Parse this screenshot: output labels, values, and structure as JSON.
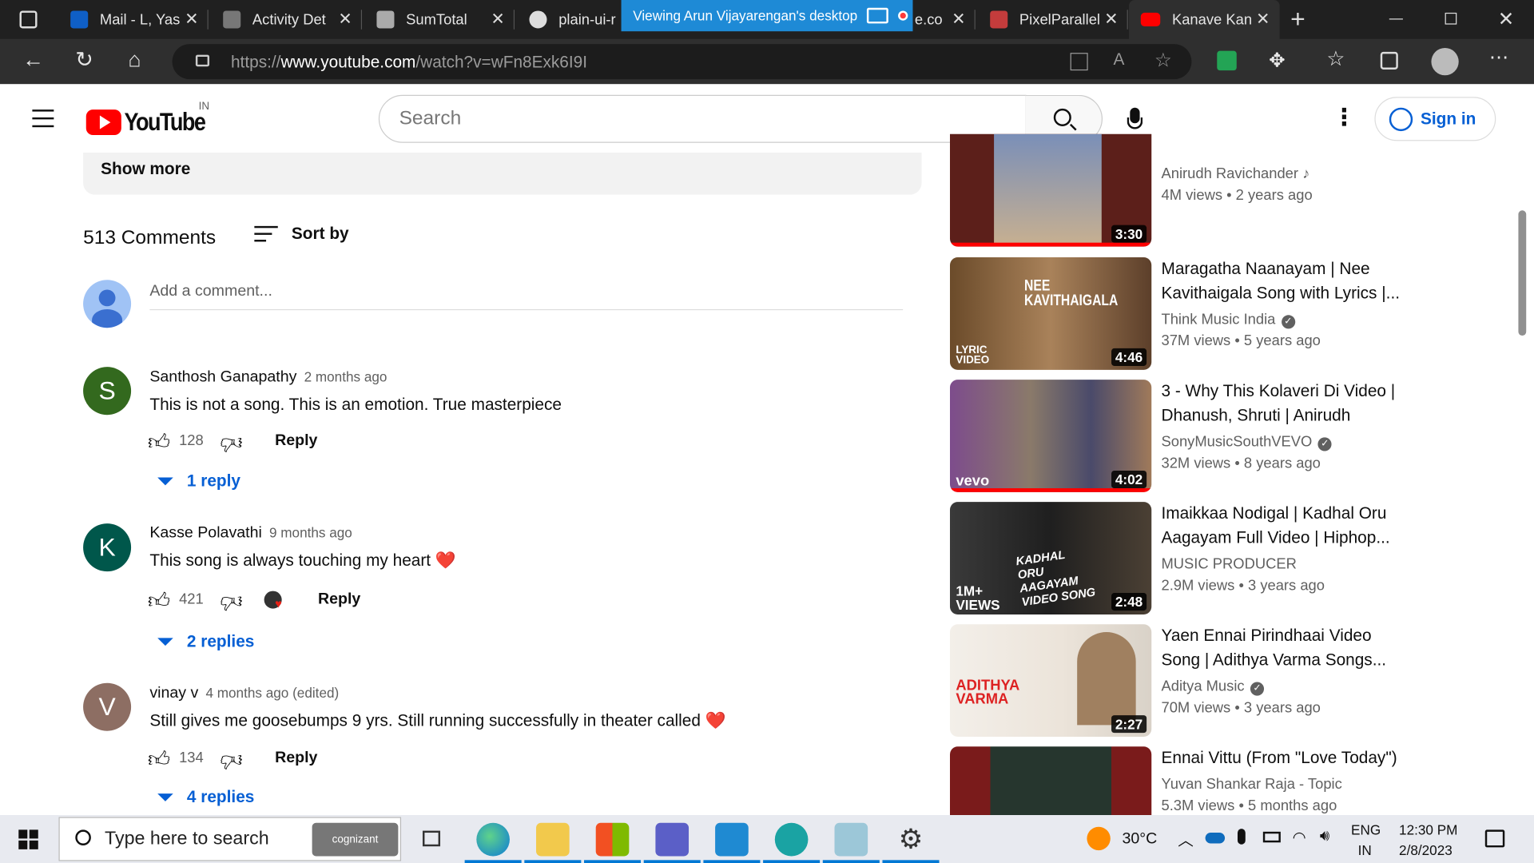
{
  "browser": {
    "tabs": [
      {
        "label": "Mail - L, Yas"
      },
      {
        "label": "Activity Det"
      },
      {
        "label": "SumTotal"
      },
      {
        "label": "plain-ui-r"
      },
      {
        "label": "e.co"
      },
      {
        "label": "PixelParallel"
      },
      {
        "label": "Kanave Kan"
      }
    ],
    "share_banner": "Viewing Arun Vijayarengan's desktop",
    "url_prefix": "https://",
    "url_domain": "www.youtube.com",
    "url_path": "/watch?v=wFn8Exk6I9I"
  },
  "youtube": {
    "logo_text": "YouTube",
    "region": "IN",
    "search_placeholder": "Search",
    "sign_in": "Sign in"
  },
  "description": {
    "show_more": "Show more"
  },
  "comments_section": {
    "count_label": "513 Comments",
    "sort_label": "Sort by",
    "add_placeholder": "Add a comment...",
    "comments": [
      {
        "initial": "S",
        "color": "#33691e",
        "author": "Santhosh Ganapathy",
        "time": "2 months ago",
        "text": "This is not a song. This is an emotion. True masterpiece",
        "likes": "128",
        "reply": "Reply",
        "replies": "1 reply"
      },
      {
        "initial": "K",
        "color": "#00574b",
        "author": "Kasse Polavathi",
        "time": "9 months ago",
        "text": "This song is always touching my heart ❤️",
        "likes": "421",
        "reply": "Reply",
        "replies": "2 replies"
      },
      {
        "initial": "V",
        "color": "#8d6e63",
        "author": "vinay v",
        "time": "4 months ago (edited)",
        "text": "Still gives me goosebumps 9 yrs. Still running successfully in theater called ❤️",
        "likes": "134",
        "reply": "Reply",
        "replies": "4 replies"
      }
    ]
  },
  "sidebar": {
    "videos": [
      {
        "title": "",
        "channel": "Anirudh Ravichander ♪",
        "views": "4M views",
        "age": "2 years ago",
        "duration": "3:30",
        "thumb_color": "#5c1f1a"
      },
      {
        "title": "Maragatha Naanayam | Nee Kavithaigala Song with Lyrics |...",
        "channel": "Think Music India",
        "verified": true,
        "views": "37M views",
        "age": "5 years ago",
        "duration": "4:46",
        "thumb_color": "#6b4b2a",
        "overlay": "NEE KAVITHAIGALA",
        "badge": "LYRIC VIDEO"
      },
      {
        "title": "3 - Why This Kolaveri Di Video | Dhanush, Shruti | Anirudh",
        "channel": "SonyMusicSouthVEVO",
        "verified": true,
        "views": "32M views",
        "age": "8 years ago",
        "duration": "4:02",
        "thumb_color": "#6a5b4e",
        "badge": "vevo"
      },
      {
        "title": "Imaikkaa Nodigal | Kadhal Oru Aagayam Full Video | Hiphop...",
        "channel": "MUSIC PRODUCER",
        "views": "2.9M views",
        "age": "3 years ago",
        "duration": "2:48",
        "thumb_color": "#2b2b2b",
        "overlay": "KADHAL ORU AAGAYAM VIDEO SONG",
        "badge": "1M+ VIEWS"
      },
      {
        "title": "Yaen Ennai Pirindhaai Video Song | Adithya Varma Songs...",
        "channel": "Aditya Music",
        "verified": true,
        "views": "70M views",
        "age": "3 years ago",
        "duration": "2:27",
        "thumb_color": "#f3efe9",
        "overlay": "ADITHYA VARMA"
      },
      {
        "title": "Ennai Vittu (From \"Love Today\")",
        "channel": "Yuvan Shankar Raja - Topic",
        "views": "5.3M views",
        "age": "5 months ago",
        "duration": "",
        "thumb_color": "#26362e"
      }
    ]
  },
  "taskbar": {
    "search_placeholder": "Type here to search",
    "cognizant": "cognizant",
    "weather": "30°C",
    "lang": "ENG",
    "region": "IN",
    "time": "12:30 PM",
    "date": "2/8/2023"
  }
}
